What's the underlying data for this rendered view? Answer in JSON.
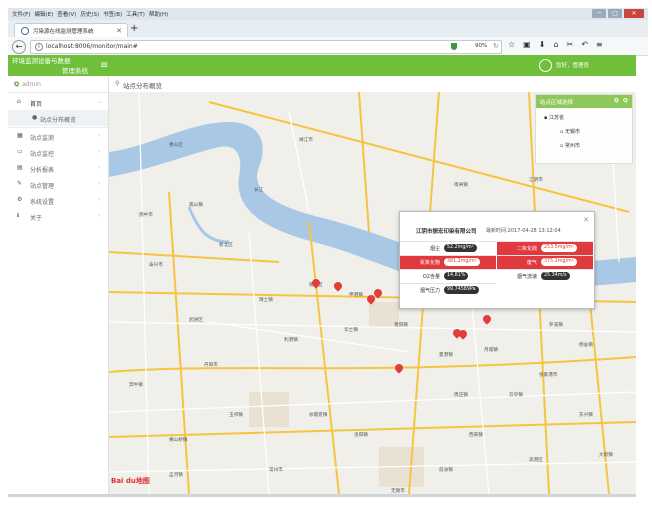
{
  "browser": {
    "menu": [
      "文件(F)",
      "编辑(E)",
      "查看(V)",
      "历史(S)",
      "书签(B)",
      "工具(T)",
      "帮助(H)"
    ],
    "tab_title": "污染源在线监测管理系统",
    "url": "localhost:8006/monitor/main#",
    "zoom": "90%",
    "window_controls": [
      "─",
      "□",
      "✕"
    ]
  },
  "header": {
    "title_line1": "环境监测设备与数据",
    "title_line2": "管理系统",
    "greeting": "您好，管理员"
  },
  "sidebar": {
    "search_placeholder": "admin",
    "items": [
      {
        "label": "首页",
        "icon": "home-icon"
      },
      {
        "label": "站点分布概览",
        "icon": "map-pin-icon"
      },
      {
        "label": "站点监测",
        "icon": "grid-icon"
      },
      {
        "label": "站点监控",
        "icon": "monitor-icon"
      },
      {
        "label": "分析报表",
        "icon": "chart-icon"
      },
      {
        "label": "站点管理",
        "icon": "wrench-icon"
      },
      {
        "label": "系统设置",
        "icon": "gear-icon"
      },
      {
        "label": "关于",
        "icon": "info-icon"
      }
    ]
  },
  "breadcrumb": {
    "label": "站点分布概览"
  },
  "map": {
    "provider": "Bai du地图",
    "tree": {
      "title": "站点区域选择",
      "nodes": [
        "江苏省",
        "无锡市",
        "常州市"
      ]
    },
    "popup": {
      "company": "江阴市振宏印染有限公司",
      "updated": "最新时间:2017-04-28 13:12:04",
      "readings": [
        {
          "label": "烟尘",
          "value": "52.2mg/m³",
          "alarm": false
        },
        {
          "label": "二氧化硫",
          "value": "253.5mg/m³",
          "alarm": true
        },
        {
          "label": "氮氧化物",
          "value": "381.2mg/m³",
          "alarm": true
        },
        {
          "label": "废气",
          "value": "375.2mg/m³",
          "alarm": true
        },
        {
          "label": "O2含量",
          "value": "14.81%",
          "alarm": false
        },
        {
          "label": "烟气流速",
          "value": "25.34m/s",
          "alarm": false
        },
        {
          "label": "烟气压力",
          "value": "99.74589Pa",
          "alarm": false
        }
      ]
    },
    "places": [
      "长江",
      "常州市",
      "无锡市",
      "江阴市",
      "张家港市",
      "扬中市",
      "泰兴市",
      "靖江市",
      "丹阳市",
      "新北区",
      "武进区",
      "惠山区",
      "锡山区",
      "高港区",
      "孤山镇",
      "西来镇",
      "南闸镇",
      "云亭镇",
      "周庄镇",
      "华士镇",
      "璜土镇",
      "利港镇",
      "申港镇",
      "夏港镇",
      "月城镇",
      "青阳镇",
      "徐霞客镇",
      "奔牛镇",
      "罗溪镇",
      "孟河镇",
      "横山桥镇",
      "洛阳镇",
      "玉祁镇",
      "前洲镇",
      "杨舍镇",
      "塘市镇",
      "大新镇",
      "新港镇",
      "东兴镇"
    ]
  },
  "colors": {
    "brand_green": "#6fbf3a",
    "alarm_red": "#e0393e",
    "marker": "#e23c3c"
  }
}
